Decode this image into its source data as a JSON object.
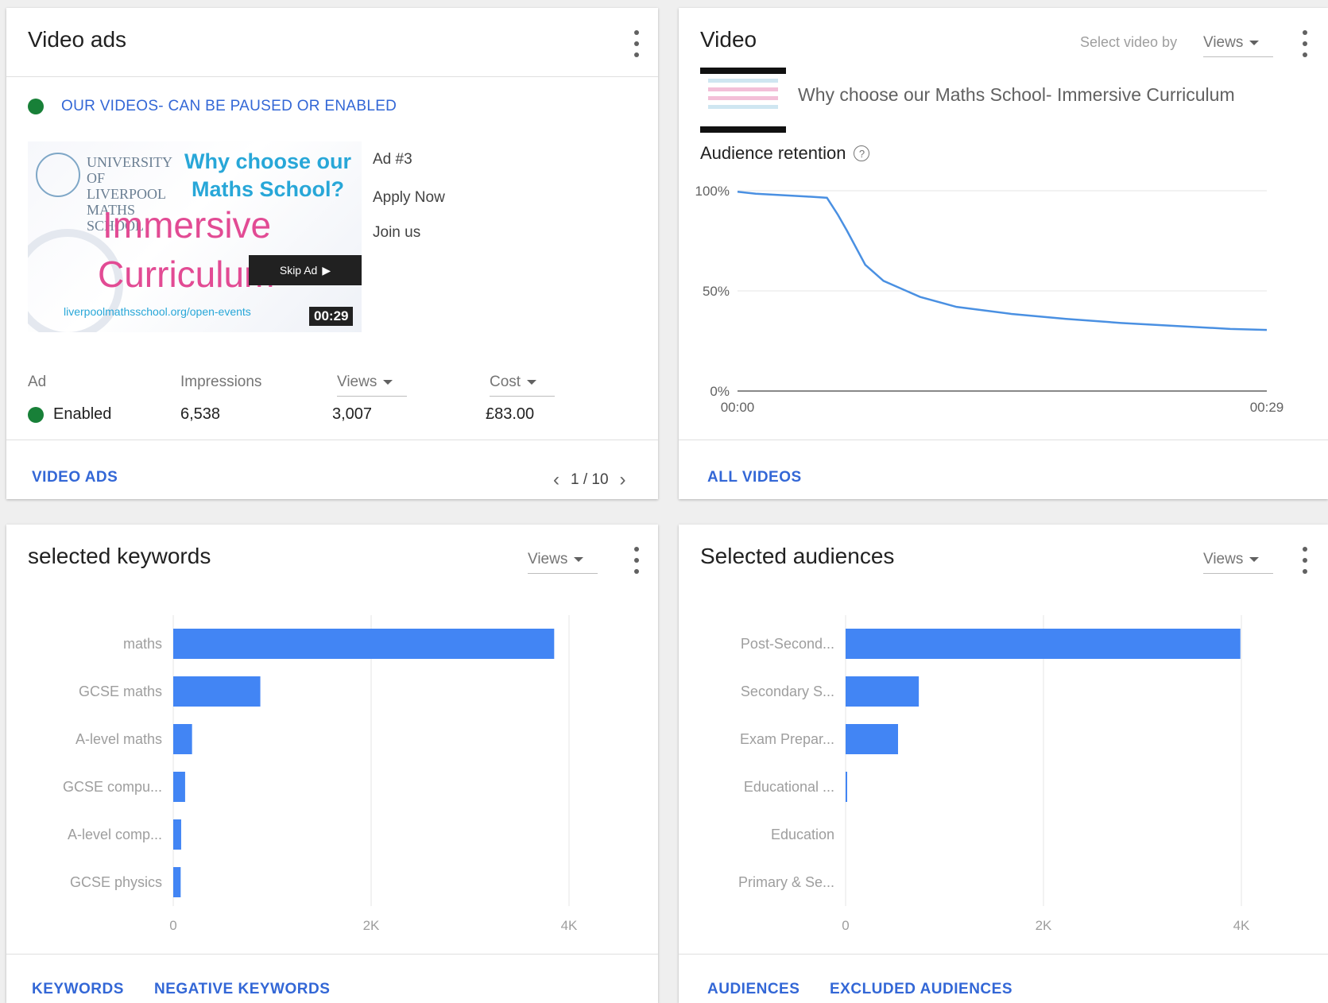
{
  "video_ads": {
    "title": "Video ads",
    "status_text": "OUR VIDEOS- CAN BE PAUSED OR ENABLED",
    "thumbnail": {
      "university": "UNIVERSITY OF LIVERPOOL MATHS SCHOOL",
      "headline": "Why choose our Maths School?",
      "line1": "Immersive",
      "line2": "Curriculum",
      "url": "liverpoolmathsschool.org/open-events",
      "skip_label": "Skip Ad",
      "duration": "00:29"
    },
    "ad_lines": [
      "Ad #3",
      "Apply Now",
      "Join us"
    ],
    "columns": {
      "ad": "Ad",
      "impressions": "Impressions",
      "views": "Views",
      "cost": "Cost"
    },
    "row": {
      "status": "Enabled",
      "impressions": "6,538",
      "views": "3,007",
      "cost": "£83.00"
    },
    "footer_link": "VIDEO ADS",
    "pager": "1 / 10"
  },
  "video": {
    "title": "Video",
    "select_by_label": "Select video by",
    "select_by_value": "Views",
    "video_name": "Why choose our Maths School- Immersive Curriculum",
    "retention_label": "Audience retention",
    "footer_link": "ALL VIDEOS",
    "chart_data": {
      "type": "line",
      "title": "",
      "xlabel": "",
      "ylabel": "",
      "x_ticks": [
        "00:00",
        "00:29"
      ],
      "y_ticks": [
        "0%",
        "50%",
        "100%"
      ],
      "ylim": [
        0,
        100
      ],
      "xlim": [
        0,
        29
      ],
      "grid": true,
      "series": [
        {
          "x": [
            0,
            1,
            2,
            3,
            4,
            4.9,
            5.5,
            6,
            7,
            8,
            10,
            12,
            15,
            18,
            21,
            24,
            27,
            29
          ],
          "y": [
            99.5,
            98.5,
            98,
            97.5,
            97,
            96.5,
            88,
            80,
            63,
            55,
            47,
            42,
            38.5,
            36,
            34,
            32.5,
            31,
            30.5
          ]
        }
      ],
      "color": "#4a90e2"
    }
  },
  "keywords": {
    "title": "selected keywords",
    "metric": "Views",
    "footer_links": [
      "KEYWORDS",
      "NEGATIVE KEYWORDS"
    ],
    "chart_data": {
      "type": "bar",
      "orientation": "horizontal",
      "title": "",
      "xlabel": "",
      "ylabel": "",
      "categories": [
        "maths",
        "GCSE maths",
        "A-level maths",
        "GCSE compu...",
        "A-level comp...",
        "GCSE physics"
      ],
      "values": [
        3850,
        880,
        190,
        120,
        80,
        75
      ],
      "x_ticks": [
        "0",
        "2K",
        "4K"
      ],
      "xlim": [
        0,
        4000
      ],
      "grid": true,
      "color": "#4285f4"
    }
  },
  "audiences": {
    "title": "Selected audiences",
    "metric": "Views",
    "footer_links": [
      "AUDIENCES",
      "EXCLUDED AUDIENCES"
    ],
    "chart_data": {
      "type": "bar",
      "orientation": "horizontal",
      "title": "",
      "xlabel": "",
      "ylabel": "",
      "categories": [
        "Post-Second...",
        "Secondary S...",
        "Exam Prepar...",
        "Educational ...",
        "Education",
        "Primary & Se..."
      ],
      "values": [
        3990,
        740,
        530,
        15,
        0,
        0
      ],
      "x_ticks": [
        "0",
        "2K",
        "4K"
      ],
      "xlim": [
        0,
        4000
      ],
      "grid": true,
      "color": "#4285f4"
    }
  }
}
